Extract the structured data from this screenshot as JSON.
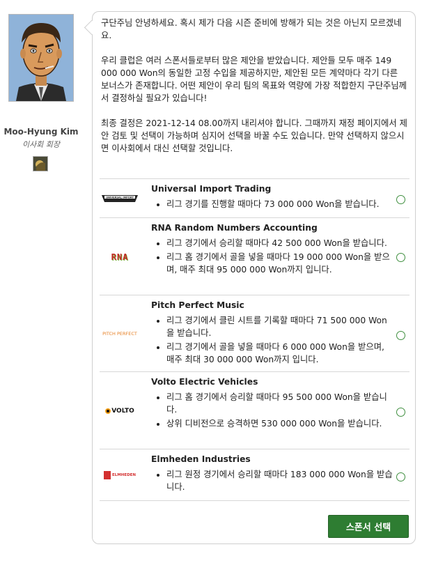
{
  "sender": {
    "name": "Moo-Hyung Kim",
    "role": "이사회 회장"
  },
  "message": {
    "paragraphs": [
      "구단주님 안녕하세요. 혹시 제가 다음 시즌 준비에 방해가 되는 것은 아닌지 모르겠네요.",
      "우리 클럽은 여러 스폰서들로부터 많은 제안을 받았습니다. 제안들 모두 매주 149 000 000 Won의 동일한 고정 수입을 제공하지만, 제안된 모든 계약마다 각기 다른 보너스가 존재합니다. 어떤 제안이 우리 팀의 목표와 역량에 가장 적합한지 구단주님께서 결정하실 필요가 있습니다!",
      "최종 결정은 2021-12-14 08.00까지 내리셔야 합니다. 그때까지 재정 페이지에서 제안 검토 및 선택이 가능하며 심지어 선택을 바꿀 수도 있습니다. 만약 선택하지 않으시면 이사회에서 대신 선택할 것입니다."
    ]
  },
  "sponsors": [
    {
      "name": "Universal Import Trading",
      "logo_text": "UNIVERSAL IMPORT",
      "bonuses": [
        "리그 경기를 진행할 때마다 73 000 000 Won을 받습니다."
      ]
    },
    {
      "name": "RNA Random Numbers Accounting",
      "logo_text": "RNA",
      "bonuses": [
        "리그 경기에서 승리할 때마다 42 500 000 Won을 받습니다.",
        "리그 홈 경기에서 골을 넣을 때마다 19 000 000 Won을 받으며, 매주 최대 95 000 000 Won까지 입니다."
      ]
    },
    {
      "name": "Pitch Perfect Music",
      "logo_text": "PITCH PERFECT",
      "bonuses": [
        "리그 경기에서 클린 시트를 기록할 때마다 71 500 000 Won을 받습니다.",
        "리그 경기에서 골을 넣을 때마다 6 000 000 Won을 받으며, 매주 최대 30 000 000 Won까지 입니다."
      ]
    },
    {
      "name": "Volto Electric Vehicles",
      "logo_text": "VOLTO",
      "bonuses": [
        "리그 홈 경기에서 승리할 때마다 95 500 000 Won을 받습니다.",
        "상위 디비전으로 승격하면 530 000 000 Won을 받습니다."
      ]
    },
    {
      "name": "Elmheden Industries",
      "logo_text": "ELMHEDEN",
      "bonuses": [
        "리그 원정 경기에서 승리할 때마다 183 000 000 Won을 받습니다."
      ]
    }
  ],
  "select_button_label": "스폰서 선택",
  "colors": {
    "accent_green": "#2e7d32",
    "radio_green": "#3f8f3f"
  }
}
